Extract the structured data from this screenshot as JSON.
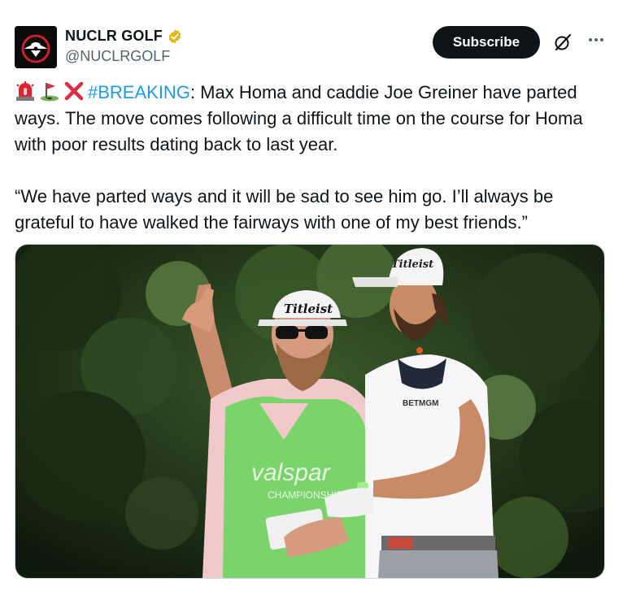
{
  "author": {
    "display_name": "NUCLR GOLF",
    "handle": "@NUCLRGOLF",
    "verified": true,
    "avatar_icon": "nuclr-logo-icon"
  },
  "actions": {
    "subscribe_label": "Subscribe",
    "grok_icon": "grok-icon",
    "more_icon": "more-icon"
  },
  "tweet": {
    "emojis": [
      "siren-emoji",
      "golf-flag-emoji",
      "cross-mark-emoji"
    ],
    "hashtag": "#BREAKING",
    "line1_rest": ": Max Homa and caddie Joe Greiner have parted ways. The move comes following a difficult time on the course for Homa with poor results dating back to last year.",
    "quote": "“We have parted ways and it will be sad to see him go. I’ll always be grateful to have walked the fairways with one of my best friends.”"
  },
  "media": {
    "cap_text_left": "Titleist",
    "cap_text_right": "Titleist",
    "vest_text": "valspar",
    "vest_subtext": "CHAMPIONSHIP",
    "shirt_text": "BETMGM"
  },
  "colors": {
    "accent": "#1d9bf0",
    "button_bg": "#0f1419",
    "verified_gold": "#e2b719"
  }
}
